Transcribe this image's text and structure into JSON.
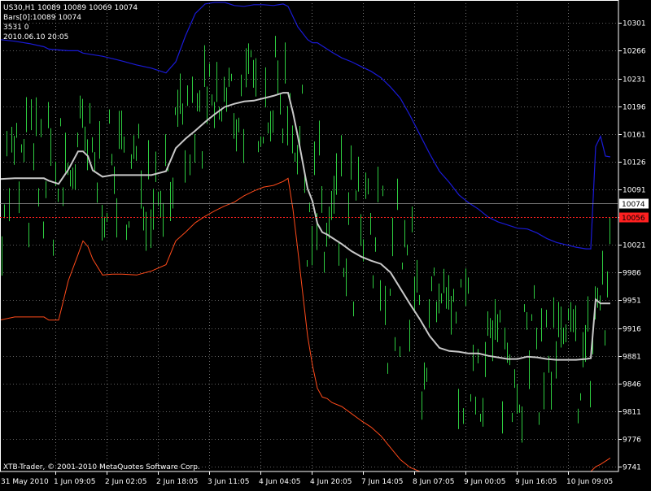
{
  "header": {
    "line1": "US30,H1  10089 10089 10069 10074",
    "line2": "Bars[0]:10089 10074",
    "line3": "3531 0",
    "line4": "2010.06.10 20:05"
  },
  "footer": {
    "copyright": "XTB-Trader, © 2001-2010 MetaQuotes Software Corp."
  },
  "colors": {
    "background": "#000000",
    "grid": "#c0c0c0",
    "candles": "#2ecc40",
    "upper_band": "#1a1ad6",
    "middle_band": "#c8c8c8",
    "lower_band": "#ff4a1a",
    "current_price_line": "#a0a0a0",
    "marker_line": "#ff2020",
    "axis_text": "#ffffff"
  },
  "chart_data": {
    "type": "line",
    "symbol": "US30",
    "timeframe": "H1",
    "y_ticks": [
      10301,
      10266,
      10231,
      10196,
      10161,
      10126,
      10091,
      10056,
      10021,
      9986,
      9951,
      9916,
      9881,
      9846,
      9811,
      9776,
      9741
    ],
    "x_ticks": [
      "31 May 2010",
      "1 Jun 09:05",
      "2 Jun 02:05",
      "2 Jun 18:05",
      "3 Jun 11:05",
      "4 Jun 04:05",
      "4 Jun 20:05",
      "7 Jun 14:05",
      "8 Jun 07:05",
      "9 Jun 00:05",
      "9 Jun 16:05",
      "10 Jun 09:05"
    ],
    "ylim": [
      9735,
      10330
    ],
    "grid": true,
    "current_price": {
      "value": 10074,
      "label": "10074"
    },
    "marker_price": {
      "value": 10056,
      "label": "10056"
    },
    "x_positions": [
      0,
      18,
      36,
      54,
      60,
      72,
      84,
      96,
      102,
      108,
      114,
      126,
      138,
      150,
      168,
      186,
      204,
      216,
      228,
      240,
      252,
      264,
      276,
      288,
      300,
      312,
      324,
      336,
      348,
      354,
      360,
      366,
      372,
      378,
      384,
      390,
      396,
      402,
      408,
      420,
      432,
      444,
      456,
      468,
      480,
      492,
      504,
      516,
      528,
      540,
      552,
      564,
      576,
      588,
      600,
      612,
      624,
      636,
      648,
      660,
      672,
      684,
      696,
      708,
      720,
      726,
      732,
      738,
      744,
      750
    ],
    "series": [
      {
        "key": "upper",
        "values": [
          10280,
          10278,
          10275,
          10271,
          10268,
          10267,
          10266,
          10266,
          10263,
          10262,
          10261,
          10259,
          10256,
          10253,
          10248,
          10244,
          10238,
          10252,
          10285,
          10313,
          10325,
          10327,
          10327,
          10323,
          10322,
          10324,
          10324,
          10323,
          10325,
          10322,
          10309,
          10296,
          10288,
          10280,
          10276,
          10276,
          10272,
          10268,
          10264,
          10257,
          10252,
          10246,
          10240,
          10232,
          10220,
          10206,
          10184,
          10160,
          10136,
          10114,
          10100,
          10084,
          10074,
          10066,
          10056,
          10050,
          10046,
          10042,
          10041,
          10036,
          10029,
          10024,
          10021,
          10018,
          10016,
          10016,
          10145,
          10158,
          10133,
          10132
        ]
      },
      {
        "key": "middle",
        "values": [
          10104,
          10105,
          10105,
          10105,
          10102,
          10098,
          10116,
          10139,
          10139,
          10133,
          10115,
          10107,
          10109,
          10109,
          10109,
          10109,
          10114,
          10143,
          10155,
          10165,
          10176,
          10186,
          10195,
          10199,
          10202,
          10203,
          10206,
          10209,
          10213,
          10213,
          10188,
          10158,
          10125,
          10092,
          10076,
          10048,
          10037,
          10034,
          10030,
          10022,
          10013,
          10006,
          10001,
          9997,
          9986,
          9966,
          9946,
          9927,
          9906,
          9891,
          9887,
          9886,
          9884,
          9884,
          9881,
          9879,
          9877,
          9877,
          9880,
          9879,
          9877,
          9876,
          9876,
          9876,
          9877,
          9878,
          9952,
          9947,
          9947,
          9947
        ]
      },
      {
        "key": "lower",
        "values": [
          9926,
          9930,
          9930,
          9930,
          9926,
          9926,
          9976,
          10009,
          10026,
          10019,
          10003,
          9983,
          9984,
          9984,
          9983,
          9988,
          9996,
          10026,
          10037,
          10049,
          10057,
          10064,
          10070,
          10075,
          10083,
          10089,
          10094,
          10096,
          10101,
          10105,
          10066,
          10014,
          9960,
          9906,
          9869,
          9840,
          9829,
          9827,
          9822,
          9817,
          9808,
          9799,
          9791,
          9780,
          9765,
          9750,
          9740,
          9735,
          9735,
          9735,
          9735,
          9735,
          9735,
          9735,
          9735,
          9735,
          9735,
          9735,
          9735,
          9735,
          9735,
          9735,
          9735,
          9735,
          9735,
          9735,
          9741,
          9744,
          9748,
          9752
        ]
      }
    ]
  }
}
